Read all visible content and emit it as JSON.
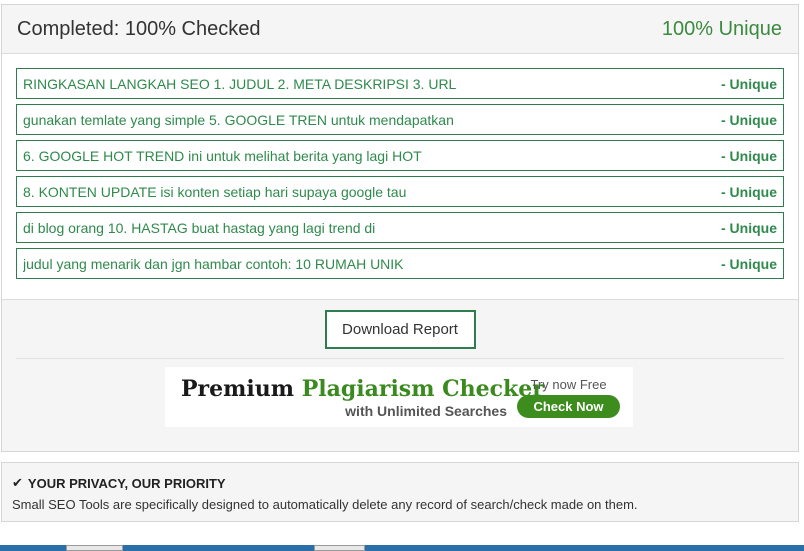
{
  "header": {
    "completed": "Completed: 100% Checked",
    "unique_total": "100% Unique"
  },
  "results": [
    {
      "text": "RINGKASAN LANGKAH SEO 1. JUDUL 2. META DESKRIPSI 3. URL",
      "tag": "- Unique"
    },
    {
      "text": "gunakan temlate yang simple 5. GOOGLE TREN untuk mendapatkan",
      "tag": "- Unique"
    },
    {
      "text": "6. GOOGLE HOT TREND ini untuk melihat berita yang lagi HOT",
      "tag": "- Unique"
    },
    {
      "text": "8. KONTEN UPDATE isi konten setiap hari supaya google tau",
      "tag": "- Unique"
    },
    {
      "text": "di blog orang 10. HASTAG buat hastag yang lagi trend di",
      "tag": "- Unique"
    },
    {
      "text": "judul yang menarik dan jgn hambar contoh: 10 RUMAH UNIK",
      "tag": "- Unique"
    }
  ],
  "actions": {
    "download_label": "Download Report"
  },
  "banner": {
    "title_main": "Premium ",
    "title_accent": "Plagiarism Checker",
    "subtitle": "with Unlimited Searches",
    "try_now": "Try now Free",
    "check_now": "Check Now"
  },
  "privacy": {
    "icon": "checkmark-icon",
    "title": "YOUR PRIVACY, OUR PRIORITY",
    "text": "Small SEO Tools are specifically designed to automatically delete any record of search/check made on them."
  },
  "colors": {
    "accent_green": "#3c8a3f",
    "border_green": "#2e7d4f",
    "button_green": "#3d8c1e"
  }
}
